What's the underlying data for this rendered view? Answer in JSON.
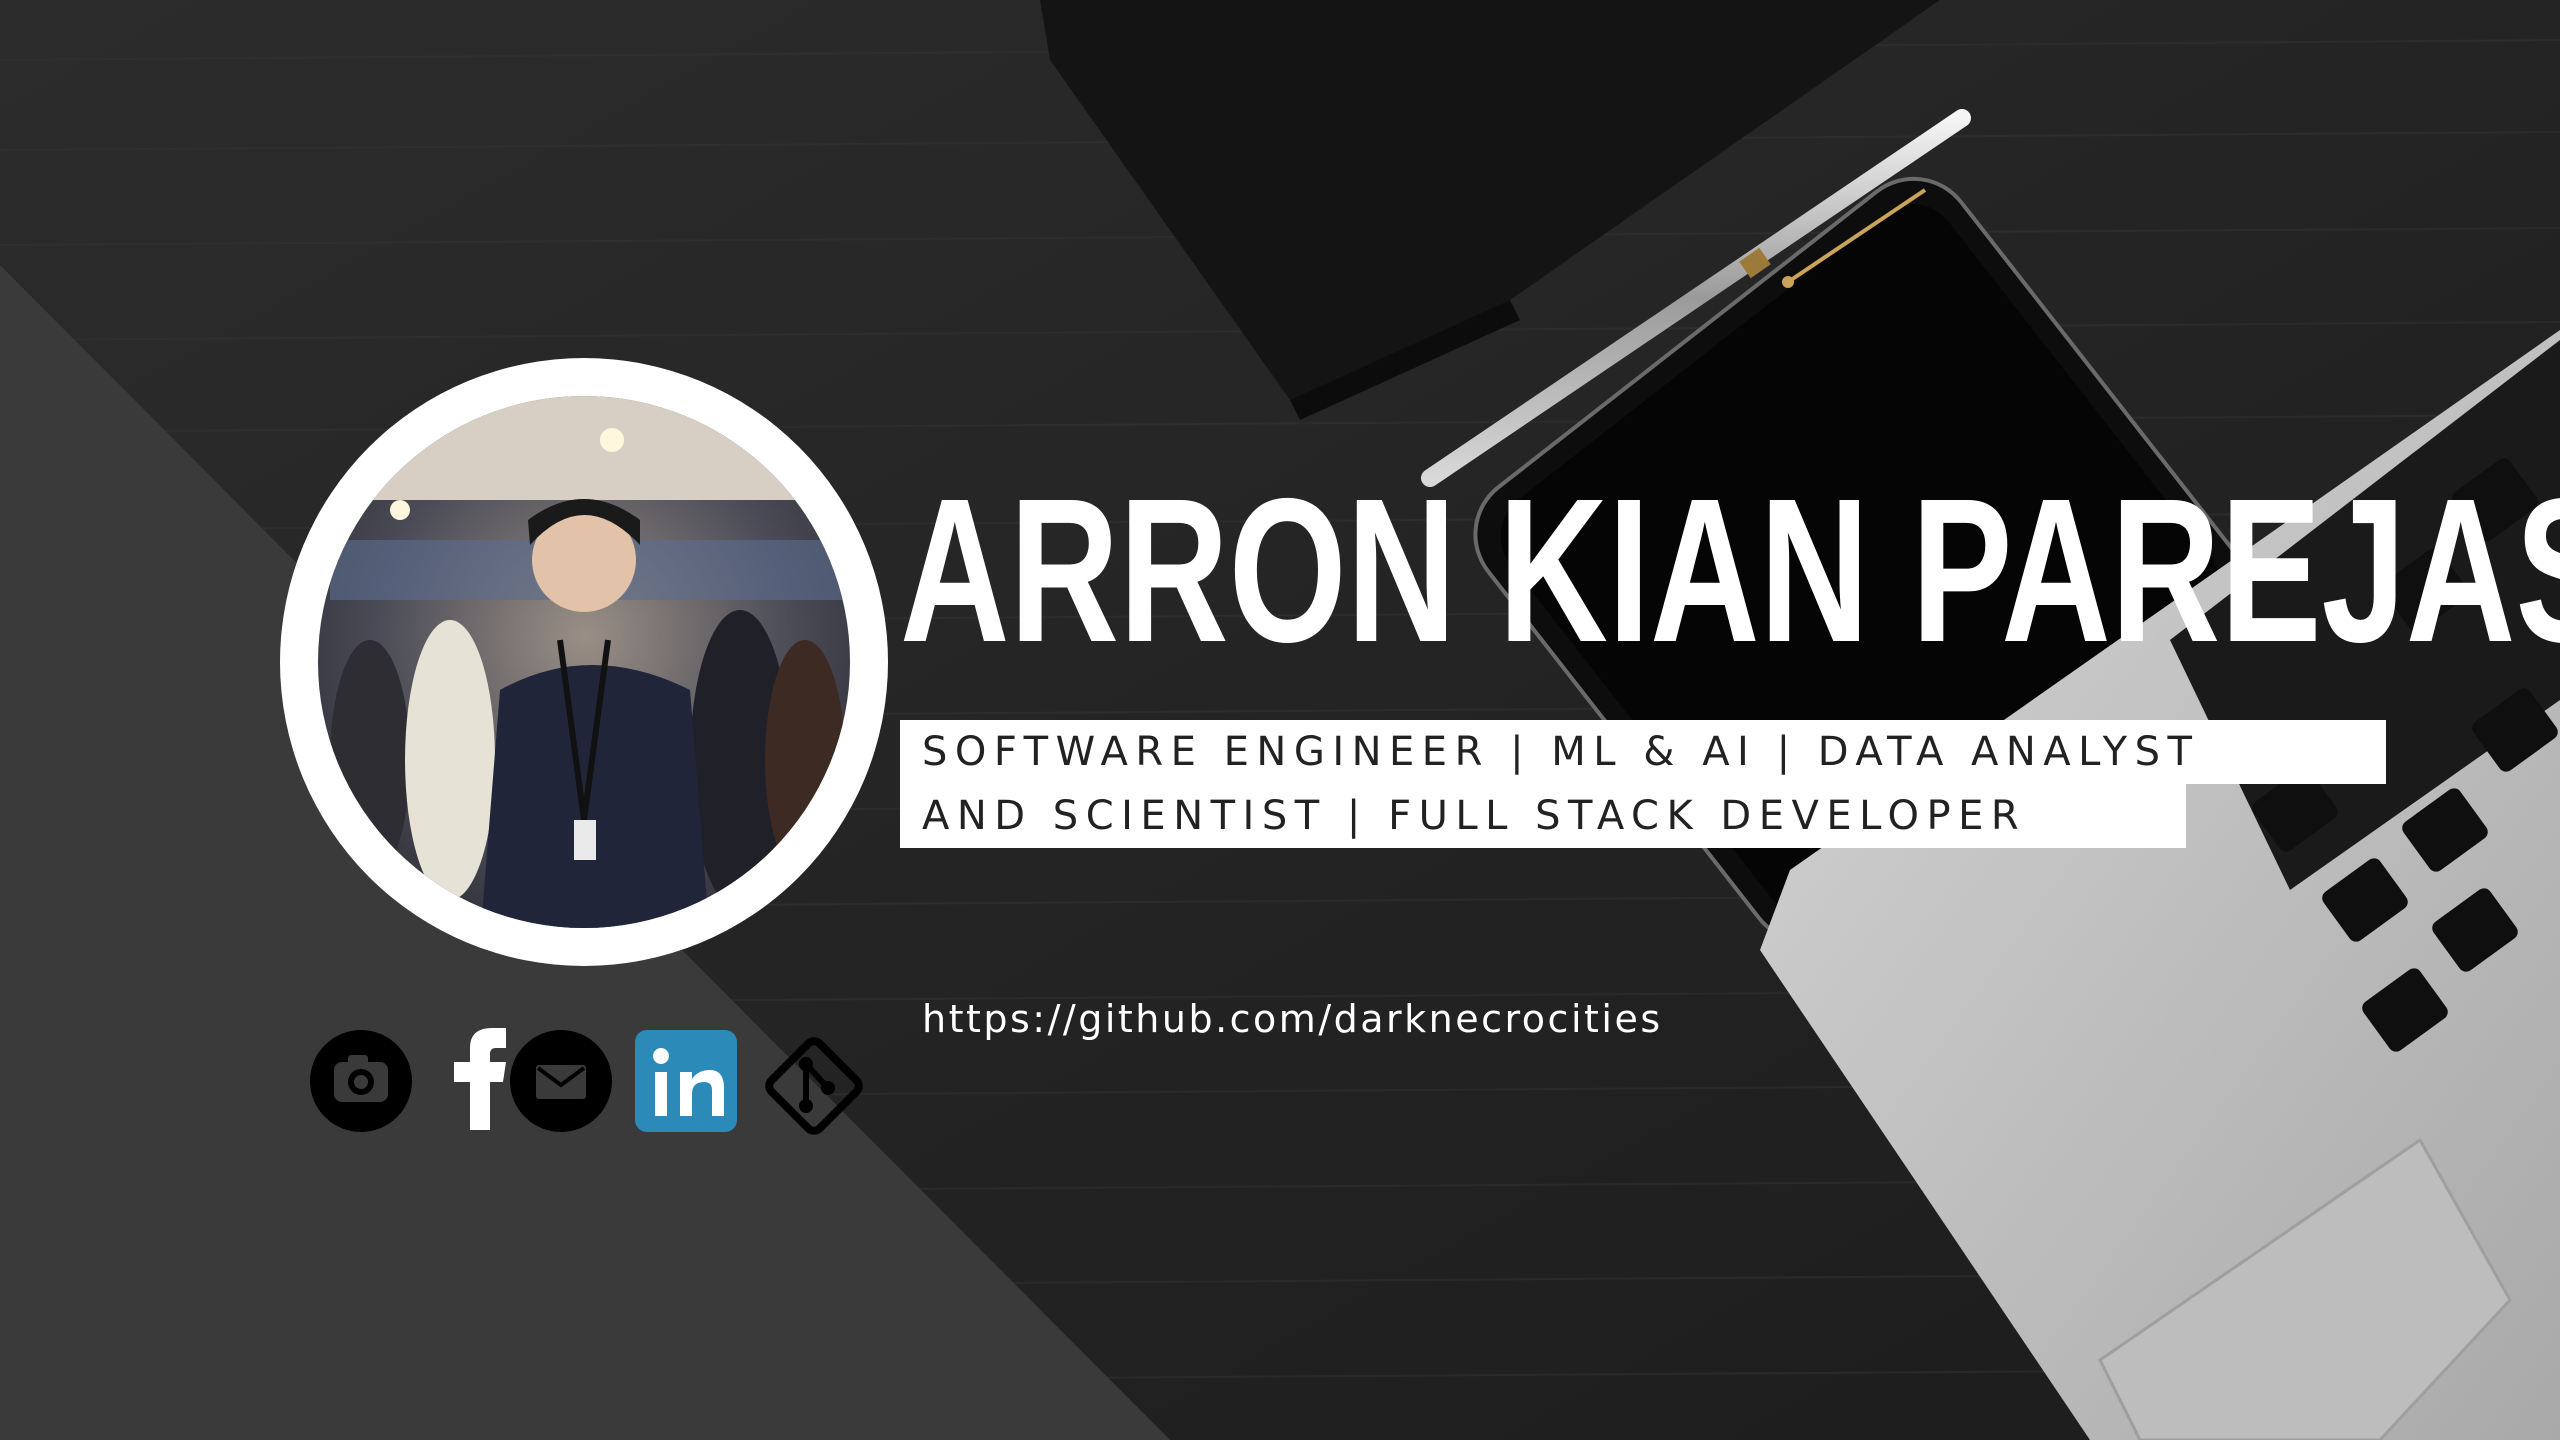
{
  "profile": {
    "name": "ARRON KIAN PAREJAS",
    "tagline_line1": "SOFTWARE ENGINEER | ML & AI | DATA ANALYST",
    "tagline_line2": "AND SCIENTIST | FULL STACK DEVELOPER",
    "url": "https://github.com/darknecrocities"
  },
  "social_icons": [
    "camera-icon",
    "facebook-icon",
    "mail-icon",
    "linkedin-icon",
    "git-icon"
  ],
  "colors": {
    "background": "#242424",
    "panel": "#3a3a3a",
    "text": "#ffffff",
    "tag_bg": "#ffffff",
    "tag_text": "#222222",
    "linkedin": "#2b8ab8"
  }
}
